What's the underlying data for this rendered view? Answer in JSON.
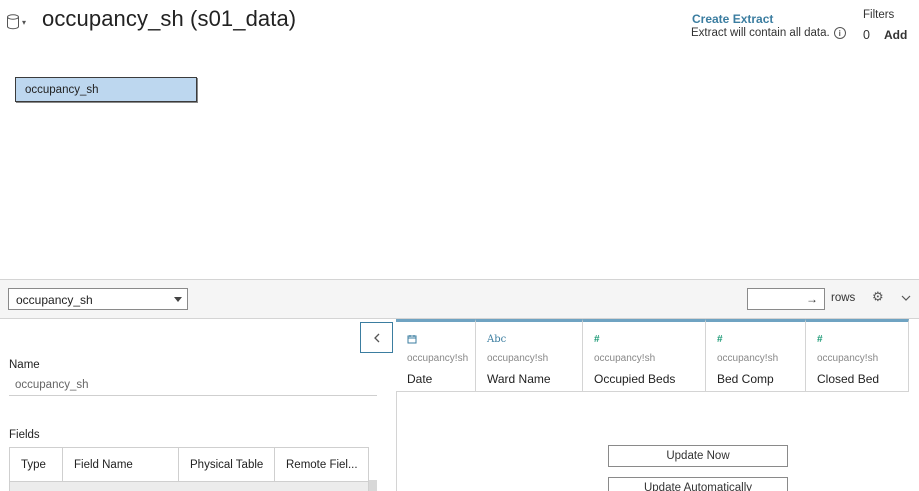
{
  "header": {
    "title": "occupancy_sh (s01_data)",
    "create_extract": "Create Extract",
    "extract_note": "Extract will contain all data.",
    "filters_label": "Filters",
    "filters_count": "0",
    "filters_add": "Add"
  },
  "canvas": {
    "table_pill": "occupancy_sh"
  },
  "toolbar": {
    "table_select": "occupancy_sh",
    "rows_value": "",
    "rows_label": "rows"
  },
  "details": {
    "name_label": "Name",
    "name_value": "occupancy_sh",
    "fields_label": "Fields",
    "columns": [
      "Type",
      "Field Name",
      "Physical Table",
      "Remote Fiel..."
    ]
  },
  "grid": {
    "columns": [
      {
        "type_icon": "calendar-icon",
        "source": "occupancy!sh",
        "name": "Date"
      },
      {
        "type_icon": "abc-icon",
        "source": "occupancy!sh",
        "name": "Ward Name"
      },
      {
        "type_icon": "hash-icon",
        "source": "occupancy!sh",
        "name": "Occupied Beds"
      },
      {
        "type_icon": "hash-icon",
        "source": "occupancy!sh",
        "name": "Bed Comp"
      },
      {
        "type_icon": "hash-icon",
        "source": "occupancy!sh",
        "name": "Closed Bed"
      }
    ],
    "update_now": "Update Now",
    "update_auto": "Update Automatically"
  },
  "colors": {
    "accent": "#3b7da0",
    "pill_fill": "#bdd7ef",
    "number_type": "#1f9b78",
    "column_top": "#6fa3c2"
  }
}
